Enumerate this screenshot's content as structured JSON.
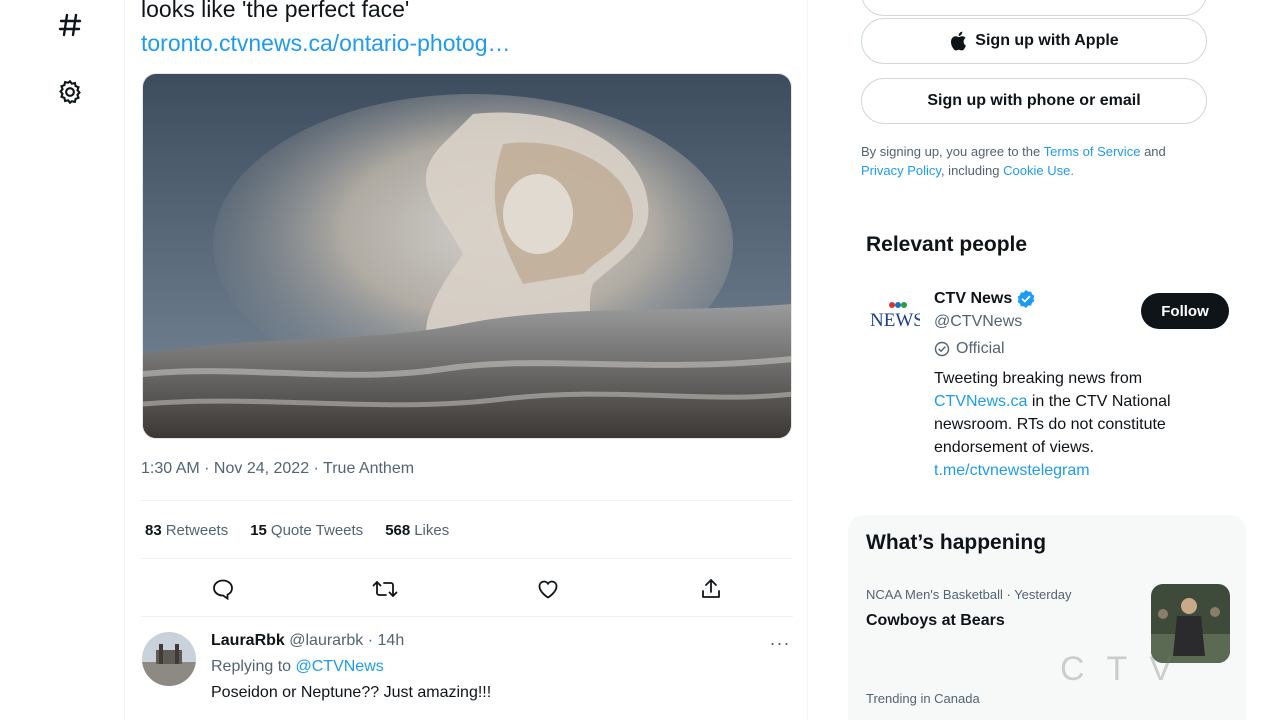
{
  "nav": {
    "explore_icon": "hashtag-icon",
    "settings_icon": "gear-icon"
  },
  "tweet": {
    "text_line": "looks like 'the perfect face'",
    "link": "toronto.ctvnews.ca/ontario-photog…",
    "time": "1:30 AM",
    "date": "Nov 24, 2022",
    "source": "True Anthem",
    "sep": " · ",
    "stats": {
      "retweets_count": "83",
      "retweets_label": "Retweets",
      "quotes_count": "15",
      "quotes_label": "Quote Tweets",
      "likes_count": "568",
      "likes_label": "Likes"
    }
  },
  "reply": {
    "name": "LauraRbk",
    "handle": "@laurarbk",
    "time": "· 14h",
    "replying_prefix": "Replying to",
    "replying_to": "@CTVNews",
    "text": "Poseidon or Neptune?? Just amazing!!!"
  },
  "signup": {
    "apple_label": "Sign up with Apple",
    "phone_label": "Sign up with phone or email",
    "legal_prefix": "By signing up, you agree to the",
    "terms": "Terms of Service",
    "and": "and",
    "privacy": "Privacy Policy",
    "including": ", including",
    "cookie": "Cookie Use."
  },
  "relevant": {
    "title": "Relevant people",
    "person": {
      "logo_text": "NEWS",
      "name": "CTV News",
      "handle": "@CTVNews",
      "official": "Official",
      "bio_1": "Tweeting breaking news from",
      "bio_link": "CTVNews.ca",
      "bio_2": "in the CTV National newsroom. RTs do not constitute endorsement of views.",
      "bio_url": "t.me/ctvnewstelegram",
      "follow_label": "Follow"
    }
  },
  "happening": {
    "title": "What’s happening",
    "trend1_category": "NCAA Men's Basketball · Yesterday",
    "trend1_title": "Cowboys at Bears",
    "trend2_category": "Trending in Canada"
  },
  "watermark": "CTV",
  "colors": {
    "accent": "#1d9bf0",
    "text": "#0f1419",
    "muted": "#536471",
    "follow_bg": "#0f1419"
  }
}
